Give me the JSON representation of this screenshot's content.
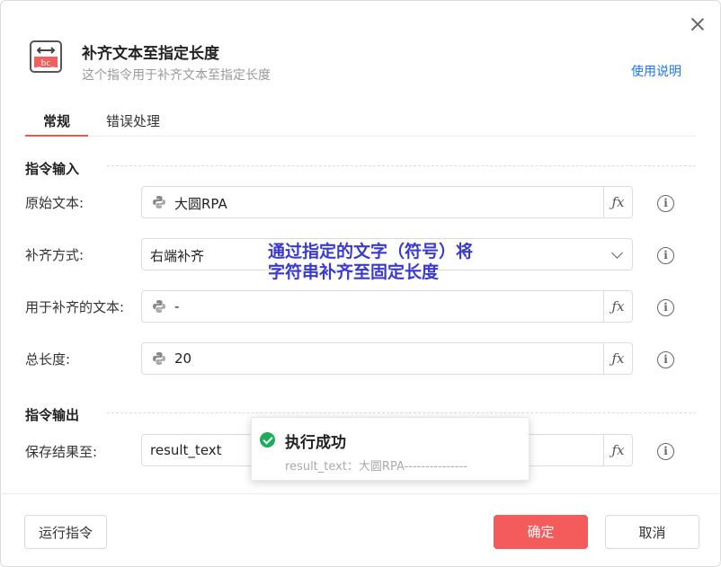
{
  "header": {
    "title": "补齐文本至指定长度",
    "subtitle": "这个指令用于补齐文本至指定长度",
    "help_link": "使用说明",
    "icon_text": "_bc_"
  },
  "tabs": [
    {
      "label": "常规",
      "active": true
    },
    {
      "label": "错误处理",
      "active": false
    }
  ],
  "input_section": {
    "title": "指令输入",
    "fields": [
      {
        "label": "原始文本:",
        "value": "大圆RPA",
        "kind": "python-expression"
      },
      {
        "label": "补齐方式:",
        "value": "右端补齐",
        "kind": "select"
      },
      {
        "label": "用于补齐的文本:",
        "value": "-",
        "kind": "python-expression"
      },
      {
        "label": "总长度:",
        "value": "20",
        "kind": "python-expression"
      }
    ]
  },
  "output_section": {
    "title": "指令输出",
    "fields": [
      {
        "label": "保存结果至:",
        "value": "result_text",
        "kind": "variable"
      }
    ]
  },
  "fx_label": "ƒx",
  "info_icon": "i",
  "annotation": {
    "line1": "通过指定的文字（符号）将",
    "line2": "字符串补齐至固定长度"
  },
  "toast": {
    "title": "执行成功",
    "message": "result_text：大圆RPA---------------"
  },
  "footer": {
    "run_label": "运行指令",
    "ok_label": "确定",
    "cancel_label": "取消"
  },
  "colors": {
    "primary": "#f45b5b",
    "link": "#1677ff",
    "annotation": "#3a3ad0",
    "success": "#1aad5a"
  }
}
